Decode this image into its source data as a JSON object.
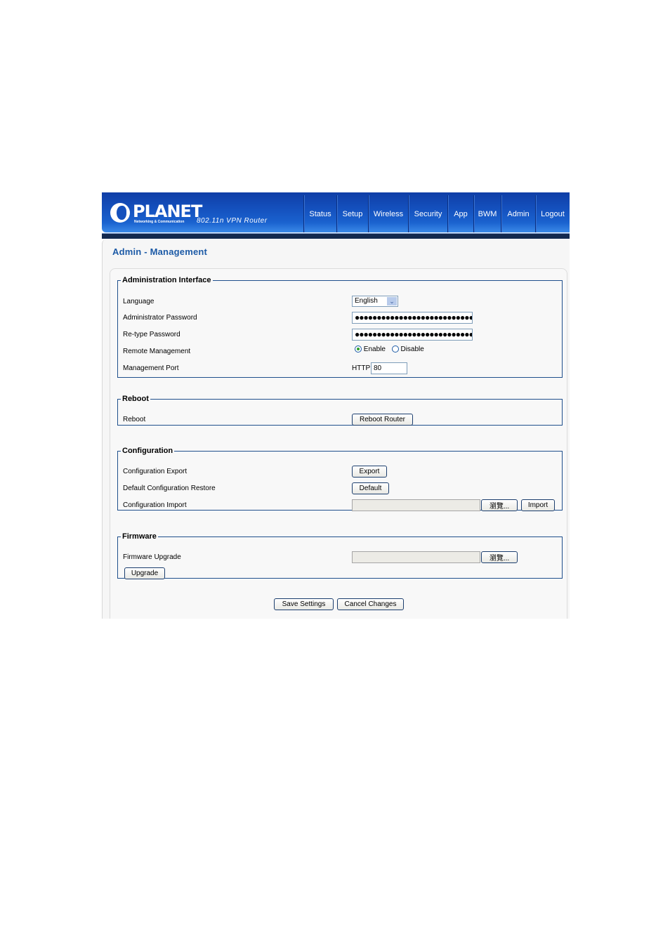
{
  "header": {
    "brand": "PLANET",
    "tagline": "Networking & Communication",
    "model": "802.11n VPN Router",
    "nav": [
      {
        "label": "Status"
      },
      {
        "label": "Setup"
      },
      {
        "label": "Wireless"
      },
      {
        "label": "Security"
      },
      {
        "label": "App"
      },
      {
        "label": "BWM"
      },
      {
        "label": "Admin"
      },
      {
        "label": "Logout"
      }
    ]
  },
  "page": {
    "title": "Admin - Management"
  },
  "admin_interface": {
    "legend": "Administration Interface",
    "language_label": "Language",
    "language_value": "English",
    "admin_password_label": "Administrator Password",
    "admin_password_value": "●●●●●●●●●●●●●●●●●●●●●●●●●●●●●●",
    "retype_password_label": "Re-type Password",
    "retype_password_value": "●●●●●●●●●●●●●●●●●●●●●●●●●●●●●●",
    "remote_mgmt_label": "Remote Management",
    "remote_enable": "Enable",
    "remote_disable": "Disable",
    "remote_selected": "Enable",
    "mgmt_port_label": "Management Port",
    "mgmt_port_prefix": "HTTP",
    "mgmt_port_value": "80"
  },
  "reboot": {
    "legend": "Reboot",
    "label": "Reboot",
    "button": "Reboot Router"
  },
  "configuration": {
    "legend": "Configuration",
    "export_label": "Configuration Export",
    "export_button": "Export",
    "default_label": "Default Configuration Restore",
    "default_button": "Default",
    "import_label": "Configuration Import",
    "browse_button": "瀏覽...",
    "import_button": "Import"
  },
  "firmware": {
    "legend": "Firmware",
    "label": "Firmware Upgrade",
    "browse_button": "瀏覽...",
    "upgrade_button": "Upgrade"
  },
  "footer": {
    "save_button": "Save Settings",
    "cancel_button": "Cancel Changes"
  }
}
